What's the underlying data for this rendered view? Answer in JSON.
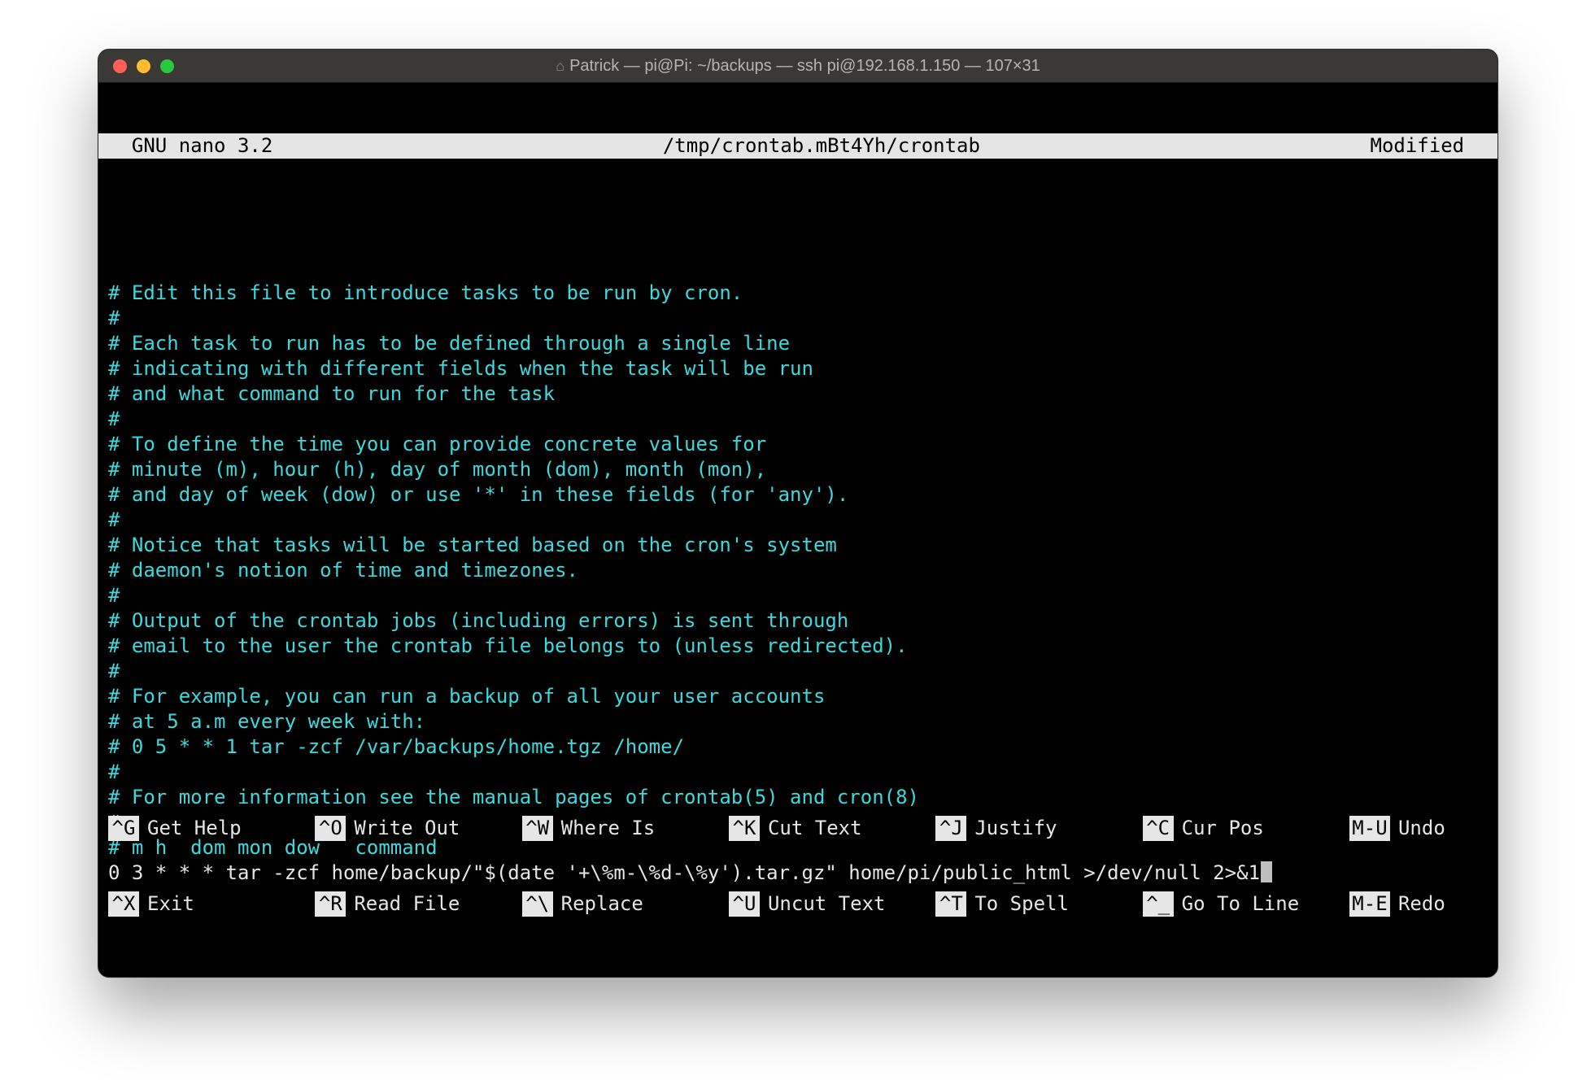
{
  "window": {
    "title": "Patrick — pi@Pi: ~/backups — ssh pi@192.168.1.150 — 107×31"
  },
  "status": {
    "left": "  GNU nano 3.2",
    "center": "/tmp/crontab.mBt4Yh/crontab",
    "right": "Modified  "
  },
  "lines": {
    "l0": "# Edit this file to introduce tasks to be run by cron.",
    "l1": "#",
    "l2": "# Each task to run has to be defined through a single line",
    "l3": "# indicating with different fields when the task will be run",
    "l4": "# and what command to run for the task",
    "l5": "#",
    "l6": "# To define the time you can provide concrete values for",
    "l7": "# minute (m), hour (h), day of month (dom), month (mon),",
    "l8": "# and day of week (dow) or use '*' in these fields (for 'any').",
    "l9": "#",
    "l10": "# Notice that tasks will be started based on the cron's system",
    "l11": "# daemon's notion of time and timezones.",
    "l12": "#",
    "l13": "# Output of the crontab jobs (including errors) is sent through",
    "l14": "# email to the user the crontab file belongs to (unless redirected).",
    "l15": "#",
    "l16": "# For example, you can run a backup of all your user accounts",
    "l17": "# at 5 a.m every week with:",
    "l18": "# 0 5 * * 1 tar -zcf /var/backups/home.tgz /home/",
    "l19": "#",
    "l20": "# For more information see the manual pages of crontab(5) and cron(8)",
    "l21": "#",
    "l22": "# m h  dom mon dow   command",
    "cmd": "0 3 * * * tar -zcf home/backup/\"$(date '+\\%m-\\%d-\\%y').tar.gz\" home/pi/public_html >/dev/null 2>&1"
  },
  "shortcuts": {
    "r1": [
      {
        "key": "^G",
        "label": "Get Help"
      },
      {
        "key": "^O",
        "label": "Write Out"
      },
      {
        "key": "^W",
        "label": "Where Is"
      },
      {
        "key": "^K",
        "label": "Cut Text"
      },
      {
        "key": "^J",
        "label": "Justify"
      },
      {
        "key": "^C",
        "label": "Cur Pos"
      }
    ],
    "r1b": {
      "key": "M-U",
      "label": "Undo"
    },
    "r2": [
      {
        "key": "^X",
        "label": "Exit"
      },
      {
        "key": "^R",
        "label": "Read File"
      },
      {
        "key": "^\\",
        "label": "Replace"
      },
      {
        "key": "^U",
        "label": "Uncut Text"
      },
      {
        "key": "^T",
        "label": "To Spell"
      },
      {
        "key": "^_",
        "label": "Go To Line"
      }
    ],
    "r2b": {
      "key": "M-E",
      "label": "Redo"
    }
  }
}
